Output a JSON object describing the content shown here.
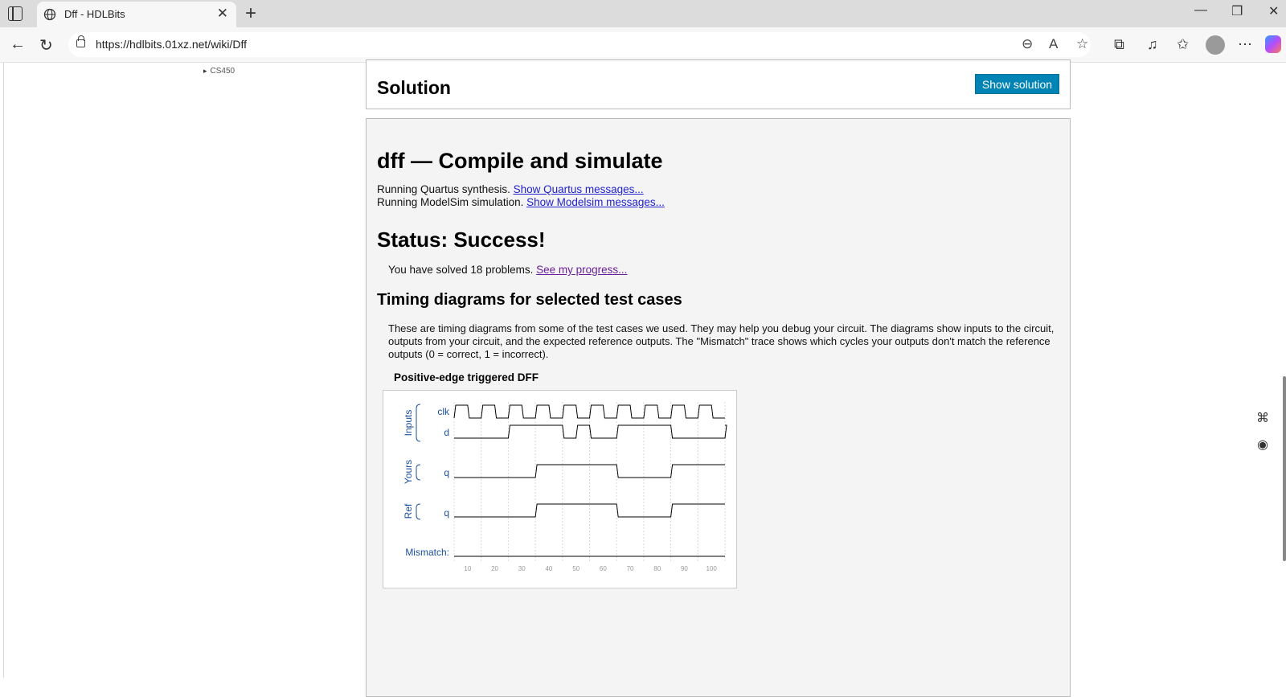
{
  "browser": {
    "tab_title": "Dff - HDLBits",
    "tab_close": "✕",
    "new_tab": "+",
    "url": "https://hdlbits.01xz.net/wiki/Dff",
    "window_controls": {
      "minimize": "—",
      "restore": "❐",
      "close": "✕"
    }
  },
  "sidebar": {
    "items": [
      {
        "label": "CS450"
      }
    ]
  },
  "solution": {
    "title": "Solution",
    "button_label": "Show solution"
  },
  "result": {
    "title": "dff — Compile and simulate",
    "quartus_text": "Running Quartus synthesis. ",
    "quartus_link": "Show Quartus messages...",
    "modelsim_text": "Running ModelSim simulation. ",
    "modelsim_link": "Show Modelsim messages...",
    "status": "Status: Success!",
    "solved_text": "You have solved 18 problems. ",
    "progress_link": "See my progress...",
    "timing_title": "Timing diagrams for selected test cases",
    "timing_desc": "These are timing diagrams from some of the test cases we used. They may help you debug your circuit. The diagrams show inputs to the circuit, outputs from your circuit, and the expected reference outputs. The \"Mismatch\" trace shows which cycles your outputs don't match the reference outputs (0 = correct, 1 = incorrect).",
    "diagram_title": "Positive-edge triggered DFF"
  },
  "waveform": {
    "groups": [
      {
        "label": "Inputs"
      },
      {
        "label": "Yours"
      },
      {
        "label": "Ref"
      }
    ],
    "signals": {
      "clk": "clk",
      "d": "d",
      "yours_q": "q",
      "ref_q": "q",
      "mismatch": "Mismatch:"
    },
    "time_ticks": [
      10,
      20,
      30,
      40,
      50,
      60,
      70,
      80,
      90,
      100
    ],
    "time_range": [
      5,
      105
    ],
    "clk_period": 10,
    "clk_first_rise": 5,
    "d_transitions": [
      [
        5,
        0
      ],
      [
        25,
        1
      ],
      [
        45,
        0
      ],
      [
        50,
        1
      ],
      [
        55,
        0
      ],
      [
        65,
        1
      ],
      [
        85,
        0
      ],
      [
        105,
        1
      ]
    ],
    "yours_q_transitions": [
      [
        5,
        0
      ],
      [
        35,
        1
      ],
      [
        65,
        0
      ],
      [
        85,
        1
      ]
    ],
    "ref_q_transitions": [
      [
        5,
        0
      ],
      [
        35,
        1
      ],
      [
        65,
        0
      ],
      [
        85,
        1
      ]
    ],
    "mismatch_transitions": [
      [
        5,
        0
      ]
    ],
    "signal_color": "#1b4f9c",
    "trace_color": "#000000"
  },
  "colors": {
    "accent_button": "#0083b5",
    "link": "#2222cc",
    "visited_link": "#6b1f9b"
  }
}
